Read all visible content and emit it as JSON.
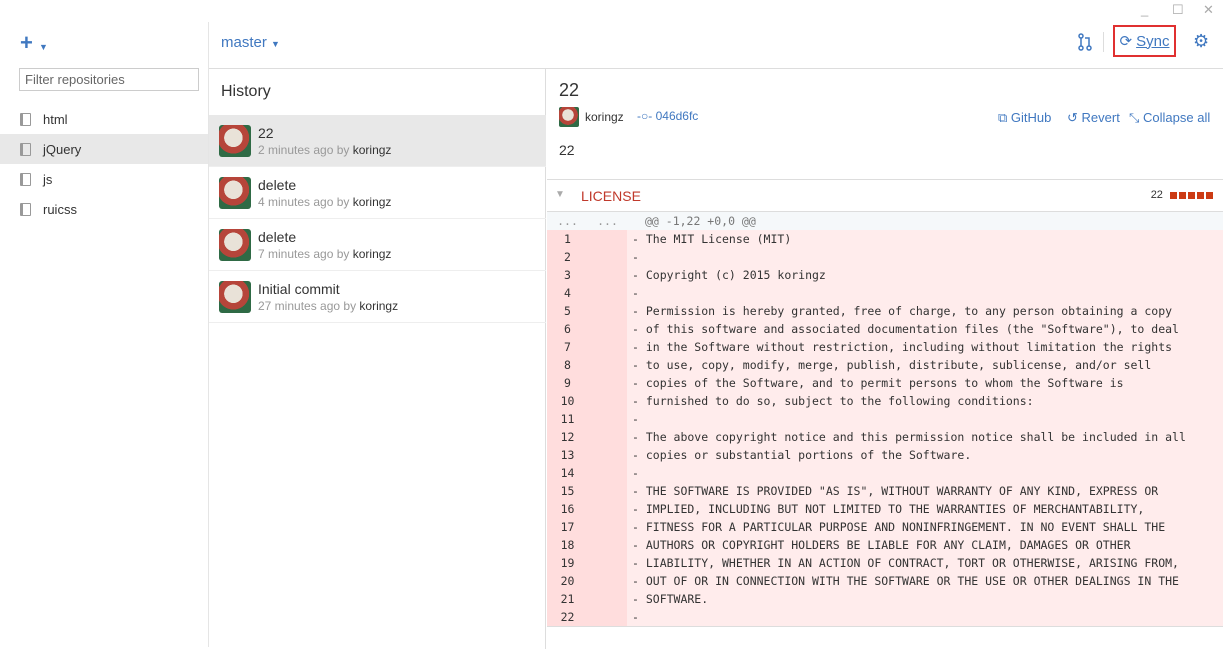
{
  "window": {
    "minimize": "_",
    "maximize": "☐",
    "close": "✕"
  },
  "sidebar": {
    "add_icon": "+",
    "filter_placeholder": "Filter repositories",
    "repos": [
      {
        "name": "html"
      },
      {
        "name": "jQuery",
        "selected": true
      },
      {
        "name": "js"
      },
      {
        "name": "ruicss"
      }
    ]
  },
  "toolbar": {
    "branch": "master",
    "sync_label": "Sync",
    "icons": [
      "pull-request-icon",
      "sync-icon",
      "gear-icon"
    ]
  },
  "history": {
    "title": "History",
    "commits": [
      {
        "title": "22",
        "time": "2 minutes ago by",
        "author": "koringz"
      },
      {
        "title": "delete",
        "time": "4 minutes ago by",
        "author": "koringz"
      },
      {
        "title": "delete",
        "time": "7 minutes ago by",
        "author": "koringz"
      },
      {
        "title": "Initial commit",
        "time": "27 minutes ago by",
        "author": "koringz"
      }
    ]
  },
  "detail": {
    "title": "22",
    "author": "koringz",
    "sha": "046d6fc",
    "description": "22",
    "actions": {
      "github": "GitHub",
      "revert": "Revert",
      "collapse": "Collapse all"
    },
    "file": {
      "name": "LICENSE",
      "deletions": "22"
    },
    "hunk": {
      "old": "...",
      "new": "...",
      "header": "@@ -1,22 +0,0 @@"
    },
    "lines": [
      "- The MIT License (MIT)",
      "-",
      "- Copyright (c) 2015 koringz",
      "-",
      "- Permission is hereby granted, free of charge, to any person obtaining a copy",
      "- of this software and associated documentation files (the \"Software\"), to deal",
      "- in the Software without restriction, including without limitation the rights",
      "- to use, copy, modify, merge, publish, distribute, sublicense, and/or sell",
      "- copies of the Software, and to permit persons to whom the Software is",
      "- furnished to do so, subject to the following conditions:",
      "-",
      "- The above copyright notice and this permission notice shall be included in all",
      "- copies or substantial portions of the Software.",
      "-",
      "- THE SOFTWARE IS PROVIDED \"AS IS\", WITHOUT WARRANTY OF ANY KIND, EXPRESS OR",
      "- IMPLIED, INCLUDING BUT NOT LIMITED TO THE WARRANTIES OF MERCHANTABILITY,",
      "- FITNESS FOR A PARTICULAR PURPOSE AND NONINFRINGEMENT. IN NO EVENT SHALL THE",
      "- AUTHORS OR COPYRIGHT HOLDERS BE LIABLE FOR ANY CLAIM, DAMAGES OR OTHER",
      "- LIABILITY, WHETHER IN AN ACTION OF CONTRACT, TORT OR OTHERWISE, ARISING FROM,",
      "- OUT OF OR IN CONNECTION WITH THE SOFTWARE OR THE USE OR OTHER DEALINGS IN THE",
      "- SOFTWARE.",
      "-"
    ]
  },
  "colors": {
    "accent": "#4078c0",
    "deleted_bg": "#ffecec",
    "highlight": "#e03030",
    "file_name": "#c0392b"
  }
}
